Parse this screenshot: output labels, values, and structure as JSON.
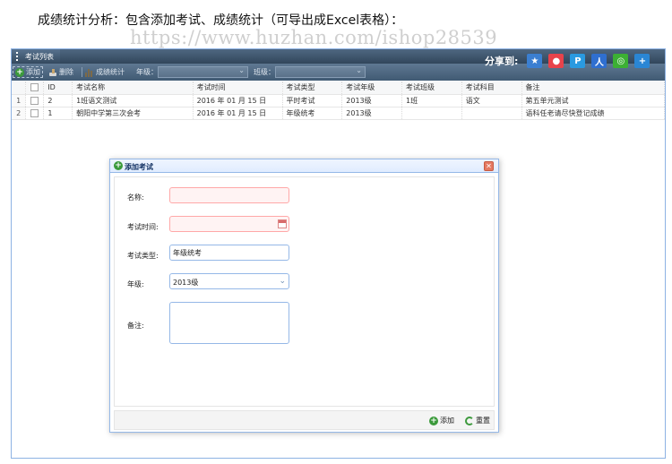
{
  "caption": "成绩统计分析：包含添加考试、成绩统计（可导出成Excel表格）：",
  "watermark": "https://www.huzhan.com/ishop28539",
  "panel": {
    "title": "考试列表"
  },
  "toolbar": {
    "add_label": "添加",
    "delete_label": "删除",
    "stats_label": "成绩统计",
    "grade_label": "年级：",
    "class_label": "班级："
  },
  "share": {
    "label": "分享到:",
    "icons": [
      {
        "name": "qzone-icon",
        "glyph": "★",
        "color": "#3b7fd1"
      },
      {
        "name": "weibo-icon",
        "glyph": "●",
        "color": "#e8434b"
      },
      {
        "name": "tencent-weibo-icon",
        "glyph": "P",
        "color": "#2a9ae0"
      },
      {
        "name": "renren-icon",
        "glyph": "人",
        "color": "#2f6fd0"
      },
      {
        "name": "wechat-icon",
        "glyph": "◎",
        "color": "#3cb034"
      },
      {
        "name": "more-share-icon",
        "glyph": "+",
        "color": "#2a86d4"
      }
    ]
  },
  "table": {
    "headers": [
      "ID",
      "考试名称",
      "考试时间",
      "考试类型",
      "考试年级",
      "考试班级",
      "考试科目",
      "备注"
    ],
    "rows": [
      {
        "num": "1",
        "id": "2",
        "name": "1班语文测试",
        "time": "2016 年 01 月 15 日",
        "type": "平时考试",
        "grade": "2013级",
        "clazz": "1班",
        "subject": "语文",
        "note": "第五单元测试"
      },
      {
        "num": "2",
        "id": "1",
        "name": "朝阳中学第三次会考",
        "time": "2016 年 01 月 15 日",
        "type": "年级统考",
        "grade": "2013级",
        "clazz": "",
        "subject": "",
        "note": "语科任老请尽快登记成绩"
      }
    ]
  },
  "dialog": {
    "title": "添加考试",
    "fields": {
      "name_label": "名称:",
      "name_value": "",
      "time_label": "考试时间:",
      "time_value": "",
      "type_label": "考试类型:",
      "type_value": "年级统考",
      "grade_label": "年级:",
      "grade_value": "2013级",
      "note_label": "备注:"
    },
    "add_label": "添加",
    "reset_label": "重置"
  }
}
